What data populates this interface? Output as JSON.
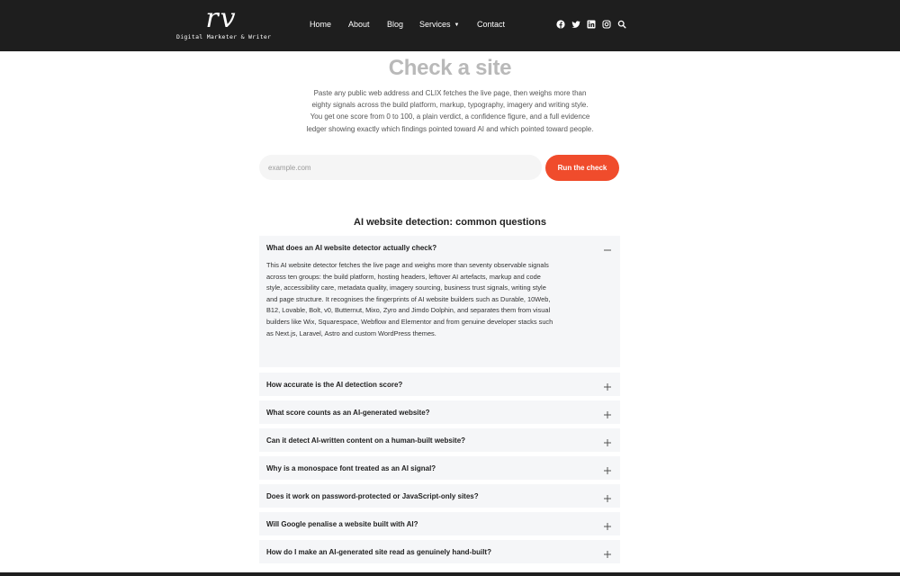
{
  "header": {
    "logo_mark": "rv",
    "logo_tagline": "Digital Marketer & Writer",
    "nav": [
      {
        "label": "Home"
      },
      {
        "label": "About"
      },
      {
        "label": "Blog"
      },
      {
        "label": "Services",
        "has_dropdown": true
      },
      {
        "label": "Contact"
      }
    ],
    "social_icons": [
      "facebook-icon",
      "twitter-icon",
      "linkedin-icon",
      "instagram-icon",
      "search-icon"
    ]
  },
  "hero": {
    "title": "Check a site",
    "description": "Paste any public web address and CLIX fetches the live page, then weighs more than eighty signals across the build platform, markup, typography, imagery and writing style. You get one score from 0 to 100, a plain verdict, a confidence figure, and a full evidence ledger showing exactly which findings pointed toward AI and which pointed toward people.",
    "input_placeholder": "example.com",
    "input_value": "",
    "button_label": "Run the check"
  },
  "faq": {
    "title": "AI website detection: common questions",
    "items": [
      {
        "question": "What does an AI website detector actually check?",
        "expanded": true,
        "answer": "This AI website detector fetches the live page and weighs more than seventy observable signals across ten groups: the build platform, hosting headers, leftover AI artefacts, markup and code style, accessibility care, metadata quality, imagery sourcing, business trust signals, writing style and page structure. It recognises the fingerprints of AI website builders such as Durable, 10Web, B12, Lovable, Bolt, v0, Butternut, Mixo, Zyro and Jimdo Dolphin, and separates them from visual builders like Wix, Squarespace, Webflow and Elementor and from genuine developer stacks such as Next.js, Laravel, Astro and custom WordPress themes."
      },
      {
        "question": "How accurate is the AI detection score?",
        "expanded": false
      },
      {
        "question": "What score counts as an AI-generated website?",
        "expanded": false
      },
      {
        "question": "Can it detect AI-written content on a human-built website?",
        "expanded": false
      },
      {
        "question": "Why is a monospace font treated as an AI signal?",
        "expanded": false
      },
      {
        "question": "Does it work on password-protected or JavaScript-only sites?",
        "expanded": false
      },
      {
        "question": "Will Google penalise a website built with AI?",
        "expanded": false
      },
      {
        "question": "How do I make an AI-generated site read as genuinely hand-built?",
        "expanded": false
      }
    ]
  },
  "colors": {
    "header_bg": "#1e1e1e",
    "accent": "#f04c2c",
    "title_gray": "#b9b9b9",
    "faq_bg": "#f5f6f8"
  }
}
